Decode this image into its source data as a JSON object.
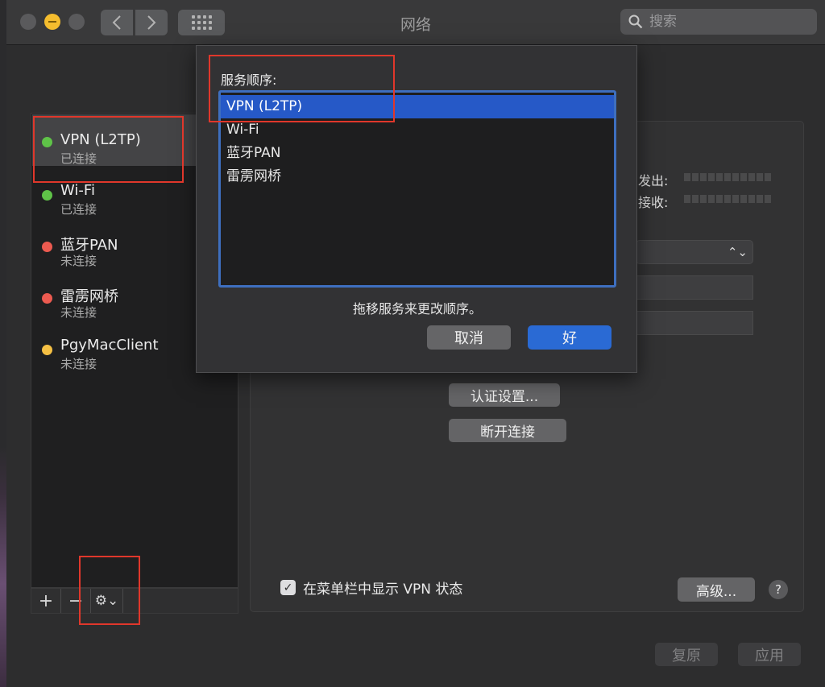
{
  "window": {
    "title": "网络"
  },
  "search": {
    "placeholder": "搜索"
  },
  "sidebar": {
    "services": [
      {
        "name": "VPN (L2TP)",
        "status": "已连接",
        "status_color": "#5fc348"
      },
      {
        "name": "Wi-Fi",
        "status": "已连接",
        "status_color": "#5fc348"
      },
      {
        "name": "蓝牙PAN",
        "status": "未连接",
        "status_color": "#ec5a50"
      },
      {
        "name": "雷雳网桥",
        "status": "未连接",
        "status_color": "#ec5a50"
      },
      {
        "name": "PgyMacClient",
        "status": "未连接",
        "status_color": "#f5c044"
      }
    ],
    "toolbar": {
      "add_label": "+",
      "remove_label": "−",
      "gear_label": "⚙⌄"
    }
  },
  "detail": {
    "sent_label": "发出:",
    "received_label": "接收:",
    "auth_button": "认证设置...",
    "disconnect_button": "断开连接",
    "show_vpn_status": {
      "checked": true,
      "label": "在菜单栏中显示 VPN 状态"
    },
    "advanced_button": "高级...",
    "help_label": "?"
  },
  "footer": {
    "revert_label": "复原",
    "apply_label": "应用"
  },
  "sheet": {
    "title": "服务顺序:",
    "items": [
      "VPN (L2TP)",
      "Wi-Fi",
      "蓝牙PAN",
      "雷雳网桥"
    ],
    "selected_index": 0,
    "hint": "拖移服务来更改顺序。",
    "cancel_label": "取消",
    "ok_label": "好"
  },
  "colors": {
    "accent": "#2a6ad4",
    "annotation": "#e0372b"
  }
}
